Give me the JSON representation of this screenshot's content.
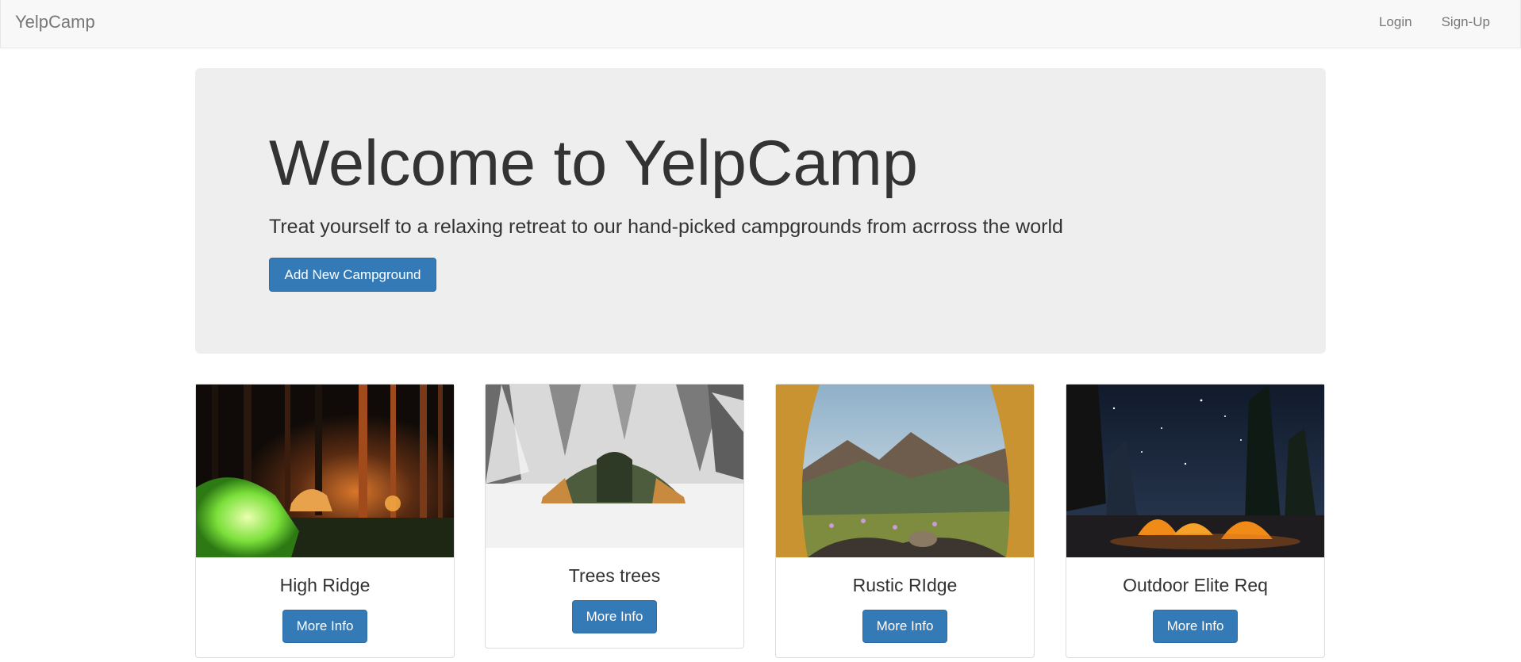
{
  "navbar": {
    "brand": "YelpCamp",
    "links": [
      "Login",
      "Sign-Up"
    ]
  },
  "jumbotron": {
    "title": "Welcome to YelpCamp",
    "lead": "Treat yourself to a relaxing retreat to our hand-picked campgrounds from acrross the world",
    "button": "Add New Campground"
  },
  "campgrounds": [
    {
      "name": "High Ridge",
      "button": "More Info",
      "image": "night-forest-tents-photo"
    },
    {
      "name": "Trees trees",
      "button": "More Info",
      "image": "snowy-tent-photo"
    },
    {
      "name": "Rustic RIdge",
      "button": "More Info",
      "image": "mountain-view-from-tent-photo"
    },
    {
      "name": "Outdoor Elite Req",
      "button": "More Info",
      "image": "starry-night-tents-photo"
    }
  ],
  "colors": {
    "primary": "#337ab7",
    "navbar_bg": "#f8f8f8",
    "jumbotron_bg": "#eeeeee"
  }
}
